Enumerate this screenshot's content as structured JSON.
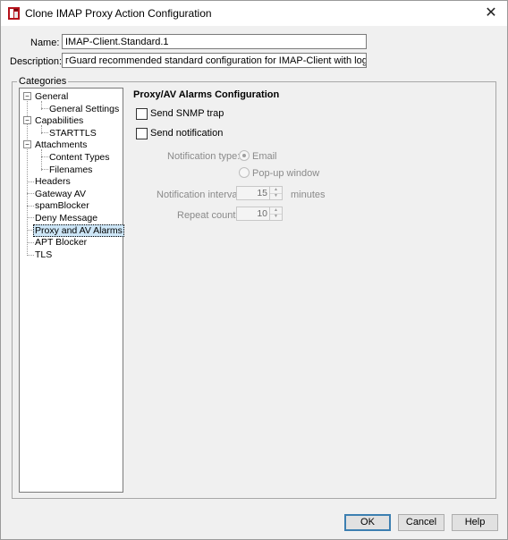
{
  "window": {
    "title": "Clone IMAP Proxy Action Configuration"
  },
  "form": {
    "name_label": "Name:",
    "name_value": "IMAP-Client.Standard.1",
    "description_label": "Description:",
    "description_value": "гGuard recommended standard configuration for IMAP-Client with logging enabled"
  },
  "categories": {
    "legend": "Categories",
    "items": [
      {
        "label": "General",
        "level": 0,
        "expander": "−"
      },
      {
        "label": "General Settings",
        "level": 1
      },
      {
        "label": "Capabilities",
        "level": 0,
        "expander": "−"
      },
      {
        "label": "STARTTLS",
        "level": 1
      },
      {
        "label": "Attachments",
        "level": 0,
        "expander": "−"
      },
      {
        "label": "Content Types",
        "level": 1
      },
      {
        "label": "Filenames",
        "level": 1
      },
      {
        "label": "Headers",
        "level": 0
      },
      {
        "label": "Gateway AV",
        "level": 0
      },
      {
        "label": "spamBlocker",
        "level": 0
      },
      {
        "label": "Deny Message",
        "level": 0
      },
      {
        "label": "Proxy and AV Alarms",
        "level": 0,
        "selected": true
      },
      {
        "label": "APT Blocker",
        "level": 0
      },
      {
        "label": "TLS",
        "level": 0
      }
    ]
  },
  "panel": {
    "title": "Proxy/AV Alarms Configuration",
    "send_snmp_trap": "Send SNMP trap",
    "send_notification": "Send notification",
    "notification_type_label": "Notification type:",
    "email_option": "Email",
    "popup_option": "Pop-up window",
    "interval_label": "Notification interval:",
    "interval_value": "15",
    "interval_unit": "minutes",
    "repeat_label": "Repeat count:",
    "repeat_value": "10"
  },
  "buttons": {
    "ok": "OK",
    "cancel": "Cancel",
    "help": "Help"
  },
  "colors": {
    "selection": "#cde6f7",
    "default_button_border": "#3c7fb1",
    "app_icon_red": "#b5121b"
  }
}
